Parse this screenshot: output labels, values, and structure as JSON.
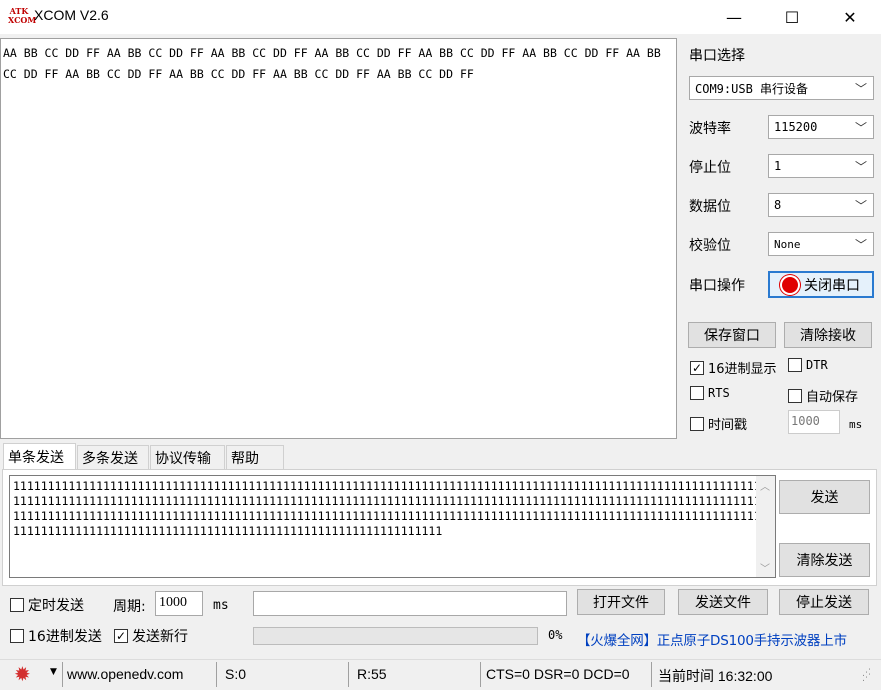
{
  "window": {
    "logo_top": "ATK",
    "logo_bottom": "XCOM",
    "title": "XCOM V2.6",
    "minimize": "—",
    "maximize": "☐",
    "close": "✕"
  },
  "receive": {
    "text": "AA BB CC DD FF AA BB CC DD FF AA BB CC DD FF AA BB CC DD FF AA BB CC DD FF AA BB CC DD FF AA BB CC DD FF AA BB CC DD FF AA BB CC DD FF AA BB CC DD FF AA BB CC DD FF"
  },
  "serial": {
    "section_title": "串口选择",
    "port_value": "COM9:USB 串行设备",
    "baud_label": "波特率",
    "baud_value": "115200",
    "stop_label": "停止位",
    "stop_value": "1",
    "data_label": "数据位",
    "data_value": "8",
    "parity_label": "校验位",
    "parity_value": "None",
    "op_label": "串口操作",
    "op_button": "关闭串口"
  },
  "panel_buttons": {
    "save_window": "保存窗口",
    "clear_receive": "清除接收"
  },
  "options": {
    "hex_display": {
      "label": "16进制显示",
      "checked": true
    },
    "dtr": {
      "label": "DTR",
      "checked": false
    },
    "rts": {
      "label": "RTS",
      "checked": false
    },
    "auto_save": {
      "label": "自动保存",
      "checked": false
    },
    "timestamp": {
      "label": "时间戳",
      "checked": false
    },
    "timestamp_value": "1000",
    "timestamp_unit": "ms"
  },
  "tabs": [
    "单条发送",
    "多条发送",
    "协议传输",
    "帮助"
  ],
  "send": {
    "text": "11111111111111111111111111111111111111111111111111111111111111111111111111111111111111111111111111111111111111111111111111111111111111111111111111111111111111111111111111111111111111111111111111111111111111111111111111111111111111111111111111111111111111111111111111111111111111111111111111111111111111111111111111111111111111111111111111111111111111111111111111111111111111111111111111111",
    "send_button": "发送",
    "clear_button": "清除发送"
  },
  "bottom": {
    "timed_send": {
      "label": "定时发送",
      "checked": false
    },
    "period_label": "周期:",
    "period_value": "1000",
    "period_unit": "ms",
    "open_file": "打开文件",
    "send_file": "发送文件",
    "stop_send": "停止发送",
    "hex_send": {
      "label": "16进制发送",
      "checked": false
    },
    "send_newline": {
      "label": "发送新行",
      "checked": true
    },
    "progress_text": "0%",
    "progress": 0,
    "promo": "【火爆全网】正点原子DS100手持示波器上市"
  },
  "status": {
    "website": "www.openedv.com",
    "sent": "S:0",
    "received": "R:55",
    "lines": "CTS=0 DSR=0 DCD=0",
    "time": "当前时间 16:32:00",
    "accent": "#d32f2f"
  }
}
